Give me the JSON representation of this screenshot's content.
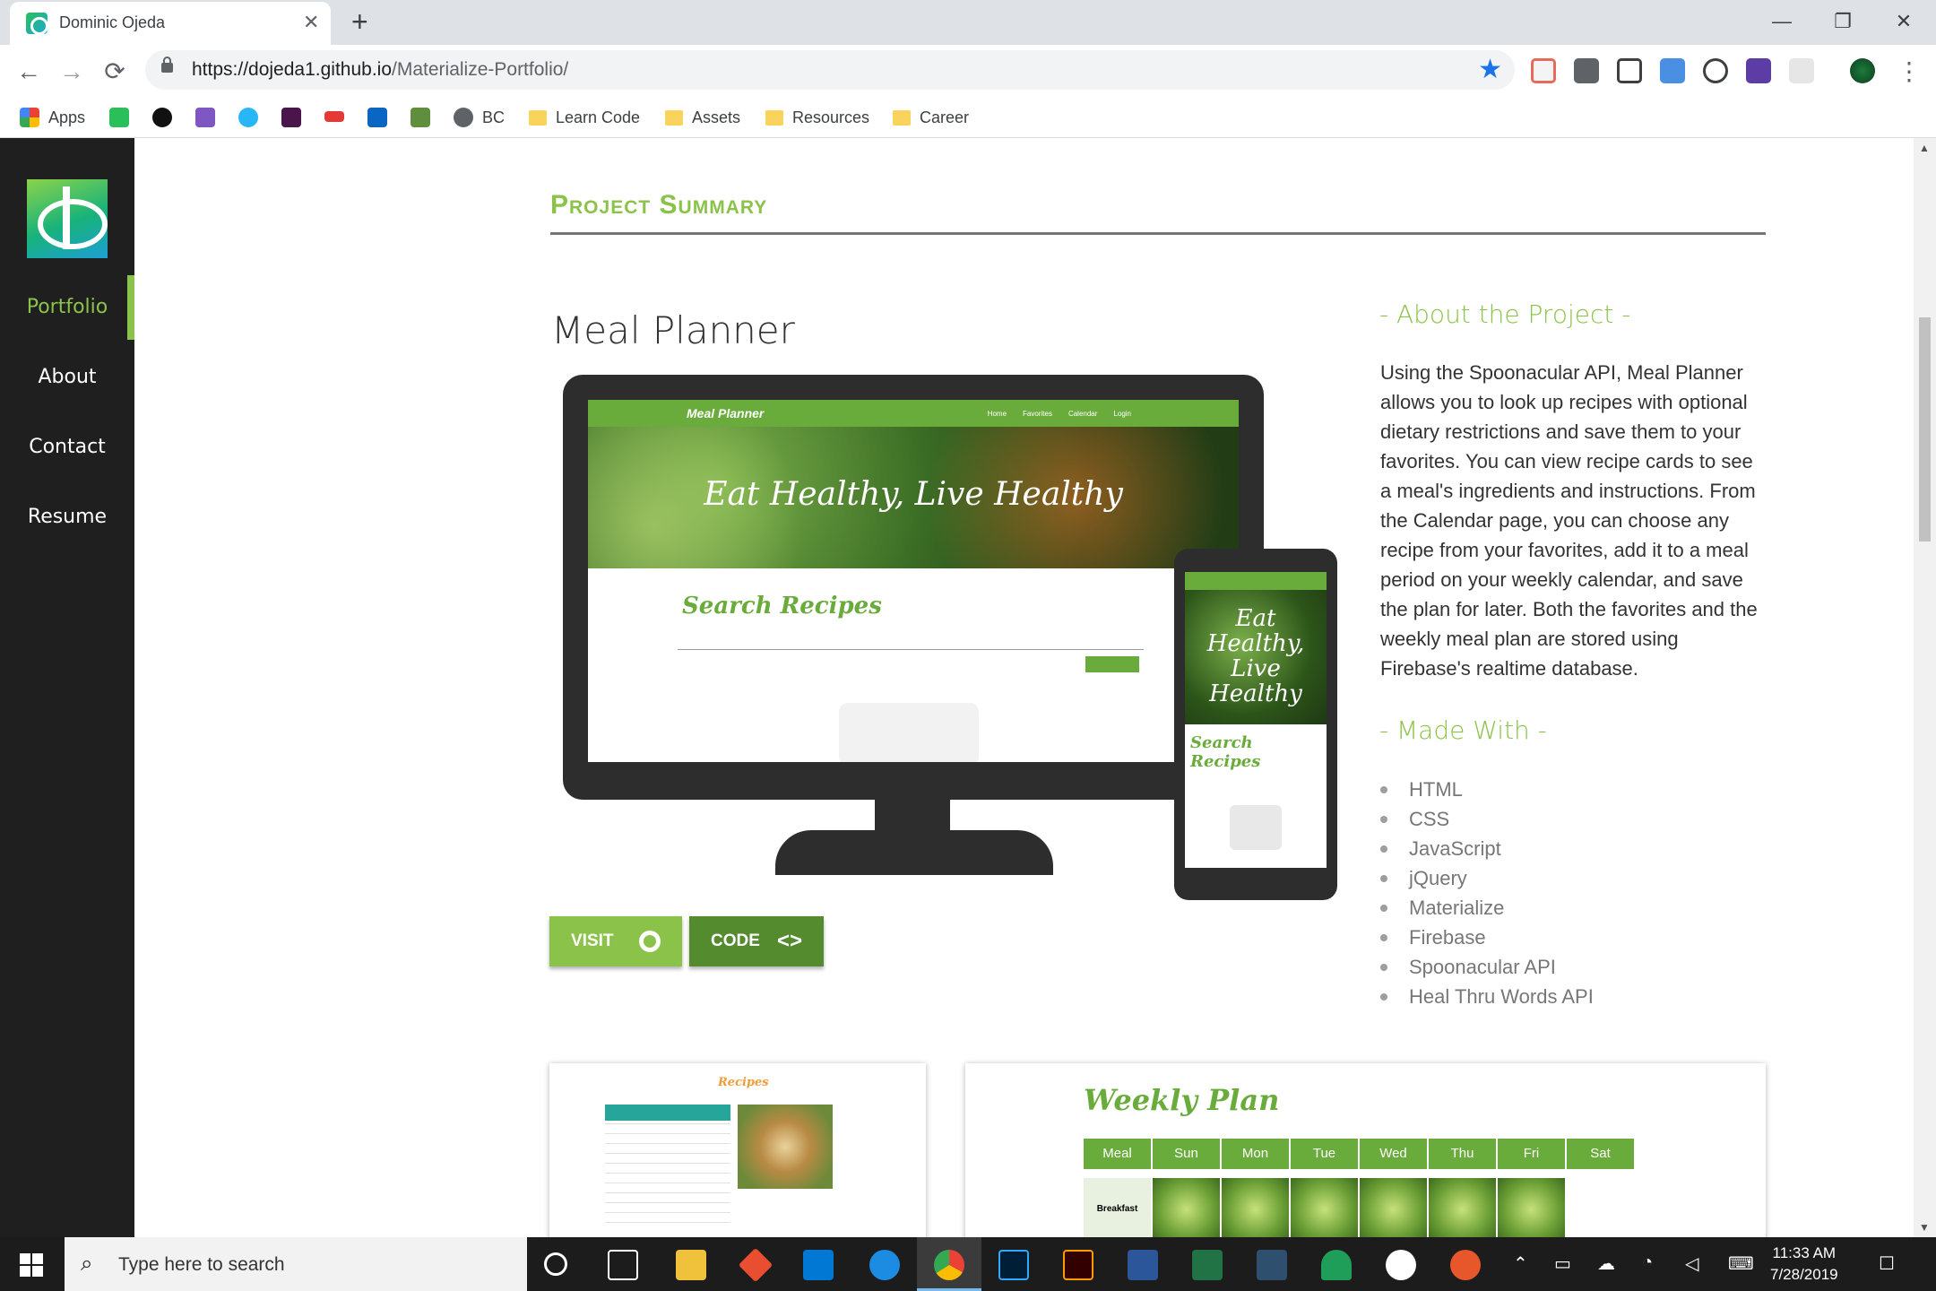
{
  "browser": {
    "tab_title": "Dominic Ojeda",
    "tab_close": "✕",
    "new_tab": "+",
    "url_main": "https://dojeda1.github.io",
    "url_path": "/Materialize-Portfolio/",
    "back": "←",
    "forward": "→",
    "reload": "⟳",
    "star": "★",
    "menu": "⋮",
    "win_min": "—",
    "win_max": "❐",
    "win_close": "✕"
  },
  "bookmarks": [
    {
      "label": "Apps"
    },
    {
      "label": "BC"
    },
    {
      "label": "Learn Code"
    },
    {
      "label": "Assets"
    },
    {
      "label": "Resources"
    },
    {
      "label": "Career"
    }
  ],
  "sidebar": {
    "items": [
      {
        "label": "Portfolio",
        "active": true
      },
      {
        "label": "About"
      },
      {
        "label": "Contact"
      },
      {
        "label": "Resume"
      }
    ]
  },
  "section": {
    "title": "Project Summary"
  },
  "project": {
    "title": "Meal Planner",
    "mockup": {
      "brand": "Meal Planner",
      "nav": [
        "Home",
        "Favorites",
        "Calendar",
        "Login"
      ],
      "hero": "Eat Healthy, Live Healthy",
      "search_title": "Search Recipes",
      "phone_hero": "Eat Healthy, Live Healthy",
      "phone_search": "Search Recipes"
    },
    "buttons": {
      "visit": "VISIT",
      "code": "CODE",
      "code_icon": "<>"
    },
    "about_heading": "- About the Project -",
    "about_text": "Using the Spoonacular API, Meal Planner allows you to look up recipes with optional dietary restrictions and save them to your favorites. You can view recipe cards to see a meal's ingredients and instructions. From the Calendar page, you can choose any recipe from your favorites, add it to a meal period on your weekly calendar, and save the plan for later. Both the favorites and the weekly meal plan are stored using Firebase's realtime database.",
    "made_heading": "- Made With -",
    "made_with": [
      "HTML",
      "CSS",
      "JavaScript",
      "jQuery",
      "Materialize",
      "Firebase",
      "Spoonacular API",
      "Heal Thru Words API"
    ]
  },
  "screenshots": {
    "recipes_title": "Recipes",
    "weekly_title": "Weekly Plan",
    "days": [
      "Meal",
      "Sun",
      "Mon",
      "Tue",
      "Wed",
      "Thu",
      "Fri",
      "Sat"
    ],
    "row_label": "Breakfast"
  },
  "taskbar": {
    "search_placeholder": "Type here to search",
    "time": "11:33 AM",
    "date": "7/28/2019"
  },
  "colors": {
    "accent": "#8bc34a",
    "accent_dark": "#558b2f",
    "sidebar": "#1f1f1f"
  }
}
